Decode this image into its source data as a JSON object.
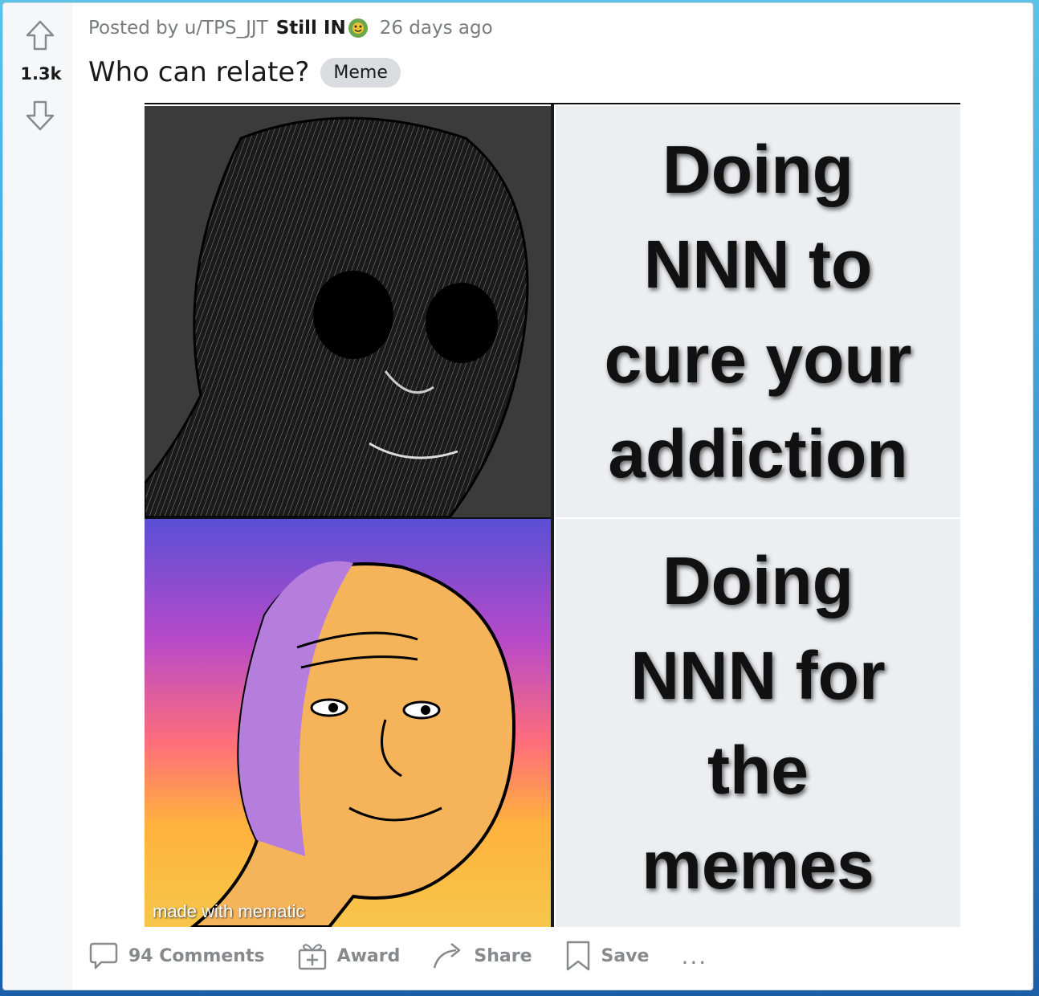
{
  "post": {
    "score": "1.3k",
    "posted_by_prefix": "Posted by",
    "username": "u/TPS_JJT",
    "user_flair": "Still IN",
    "time_ago": "26 days ago",
    "title": "Who can relate?",
    "flair_tag": "Meme"
  },
  "meme": {
    "top_text": "Doing\nNNN to\ncure your\naddiction",
    "bottom_text": "Doing\nNNN for\nthe\nmemes",
    "watermark": "made with mematic"
  },
  "actions": {
    "comments": "94 Comments",
    "award": "Award",
    "share": "Share",
    "save": "Save",
    "more": "..."
  },
  "colors": {
    "meta_text": "#787c7e",
    "action_text": "#878a8c",
    "tag_bg": "#dadcdf"
  }
}
